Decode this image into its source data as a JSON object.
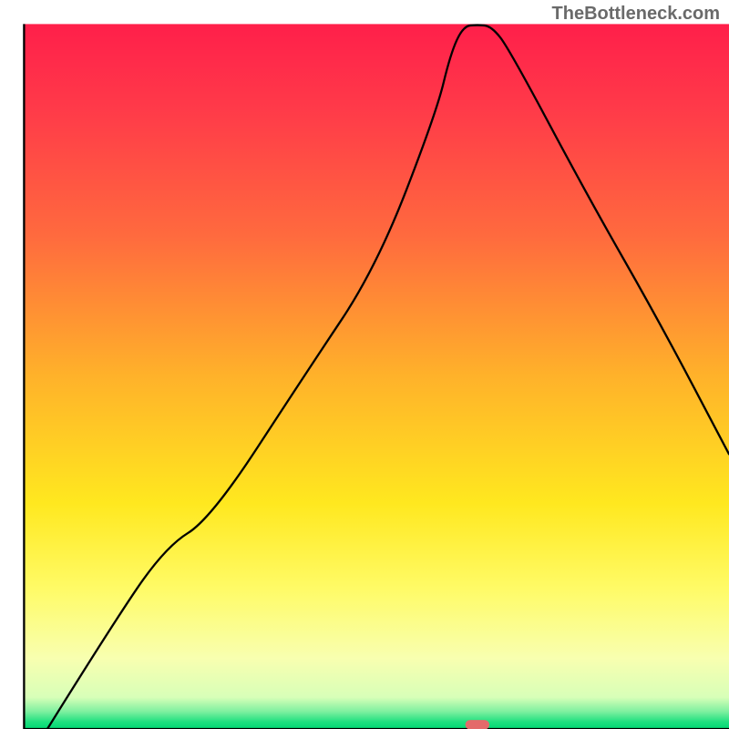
{
  "watermark": "TheBottleneck.com",
  "chart_data": {
    "type": "line",
    "title": "",
    "xlabel": "",
    "ylabel": "",
    "xlim": [
      0,
      100
    ],
    "ylim": [
      0,
      100
    ],
    "background_gradient": {
      "stops": [
        {
          "offset": 0.0,
          "color": "#ff1f4a"
        },
        {
          "offset": 0.12,
          "color": "#ff3a49"
        },
        {
          "offset": 0.3,
          "color": "#ff6a3e"
        },
        {
          "offset": 0.5,
          "color": "#ffb22a"
        },
        {
          "offset": 0.68,
          "color": "#ffe81f"
        },
        {
          "offset": 0.8,
          "color": "#fffb66"
        },
        {
          "offset": 0.9,
          "color": "#f8ffb0"
        },
        {
          "offset": 0.955,
          "color": "#d8ffb8"
        },
        {
          "offset": 0.975,
          "color": "#7ff0a0"
        },
        {
          "offset": 0.99,
          "color": "#1ee07f"
        },
        {
          "offset": 1.0,
          "color": "#00d873"
        }
      ]
    },
    "series": [
      {
        "name": "bottleneck-curve",
        "color": "#000000",
        "stroke_width": 2.3,
        "x": [
          3.3,
          12,
          20,
          26.5,
          40,
          50,
          58.5,
          60.5,
          62.3,
          64.3,
          66.3,
          68.8,
          80,
          90,
          100
        ],
        "y_top": [
          100,
          86,
          74.2,
          70.2,
          49.5,
          34.5,
          12.5,
          4.2,
          0.3,
          0.1,
          0.3,
          3.5,
          24.5,
          42,
          61
        ],
        "note": "y_top is percentage from the top of the plot area (0 = top, 100 = bottom). Curve has a minimum (near-zero) around x≈63-66 and rises on both sides."
      }
    ],
    "marker": {
      "name": "optimal-point-marker",
      "color": "#e46a6a",
      "x": 64.3,
      "y_from_bottom_pct": 0.6,
      "width_pct": 3.3,
      "height_pct": 1.3
    },
    "plot_axes": {
      "left_x_pct": 3.3,
      "right_x_pct": 100,
      "top_y_pct": 3.3,
      "bottom_y_pct": 100,
      "stroke": "#000000",
      "stroke_width": 2.3
    }
  }
}
